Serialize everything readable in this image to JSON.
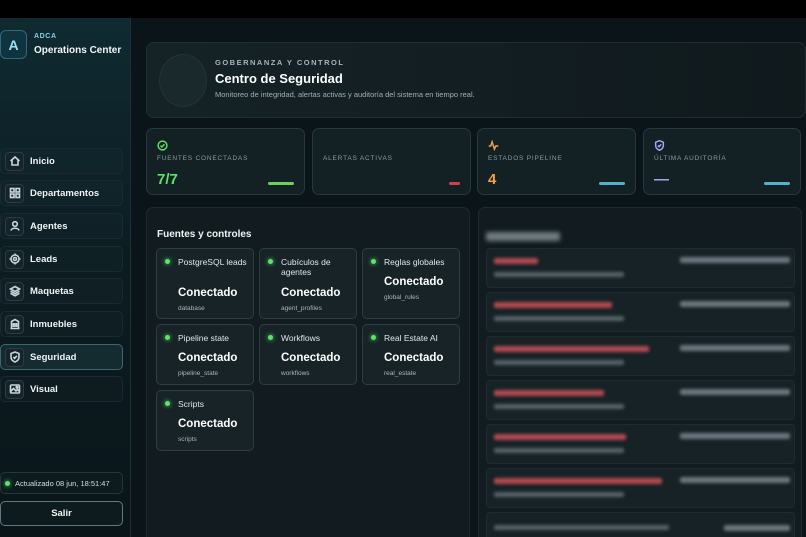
{
  "brand": {
    "logo_letter": "A",
    "small": "ADCA",
    "title": "Operations Center"
  },
  "nav": [
    {
      "label": "Inicio",
      "icon": "home-icon"
    },
    {
      "label": "Departamentos",
      "icon": "grid-icon"
    },
    {
      "label": "Agentes",
      "icon": "user-icon"
    },
    {
      "label": "Leads",
      "icon": "target-icon"
    },
    {
      "label": "Maquetas",
      "icon": "layers-icon"
    },
    {
      "label": "Inmuebles",
      "icon": "building-icon"
    },
    {
      "label": "Seguridad",
      "icon": "shield-icon",
      "active": true
    },
    {
      "label": "Visual",
      "icon": "image-icon"
    }
  ],
  "sidebar": {
    "updated": "Actualizado 08 jun, 18:51:47",
    "logout": "Salir"
  },
  "hero": {
    "kicker": "GOBERNANZA Y CONTROL",
    "title": "Centro de Seguridad",
    "subtitle": "Monitoreo de integridad, alertas activas y auditoría del sistema en tiempo real."
  },
  "stats": [
    {
      "label": "FUENTES CONECTADAS",
      "value": "7/7",
      "color": "#5ee36a",
      "icon": "check-circle-icon"
    },
    {
      "label": "ALERTAS ACTIVAS",
      "value": "",
      "color": "#d0454f",
      "icon": ""
    },
    {
      "label": "ESTADOS PIPELINE",
      "value": "4",
      "color": "#f0a24a",
      "icon": "activity-icon"
    },
    {
      "label": "ÚLTIMA AUDITORÍA",
      "value": "—",
      "color": "#a6a8f5",
      "icon": "shield-check-icon"
    }
  ],
  "stat_bar_colors": [
    "#6fcf5a",
    "#c8434c",
    "#4fb3c9",
    "#4fb3c9"
  ],
  "sources_panel": {
    "title": "Fuentes y controles",
    "items": [
      {
        "name": "PostgreSQL leads",
        "status": "Conectado",
        "key": "database"
      },
      {
        "name": "Cubículos de agentes",
        "status": "Conectado",
        "key": "agent_profiles"
      },
      {
        "name": "Reglas globales",
        "status": "Conectado",
        "key": "global_rules"
      },
      {
        "name": "Pipeline state",
        "status": "Conectado",
        "key": "pipeline_state"
      },
      {
        "name": "Workflows",
        "status": "Conectado",
        "key": "workflows"
      },
      {
        "name": "Real Estate AI",
        "status": "Conectado",
        "key": "real_estate"
      },
      {
        "name": "Scripts",
        "status": "Conectado",
        "key": "scripts"
      }
    ]
  }
}
